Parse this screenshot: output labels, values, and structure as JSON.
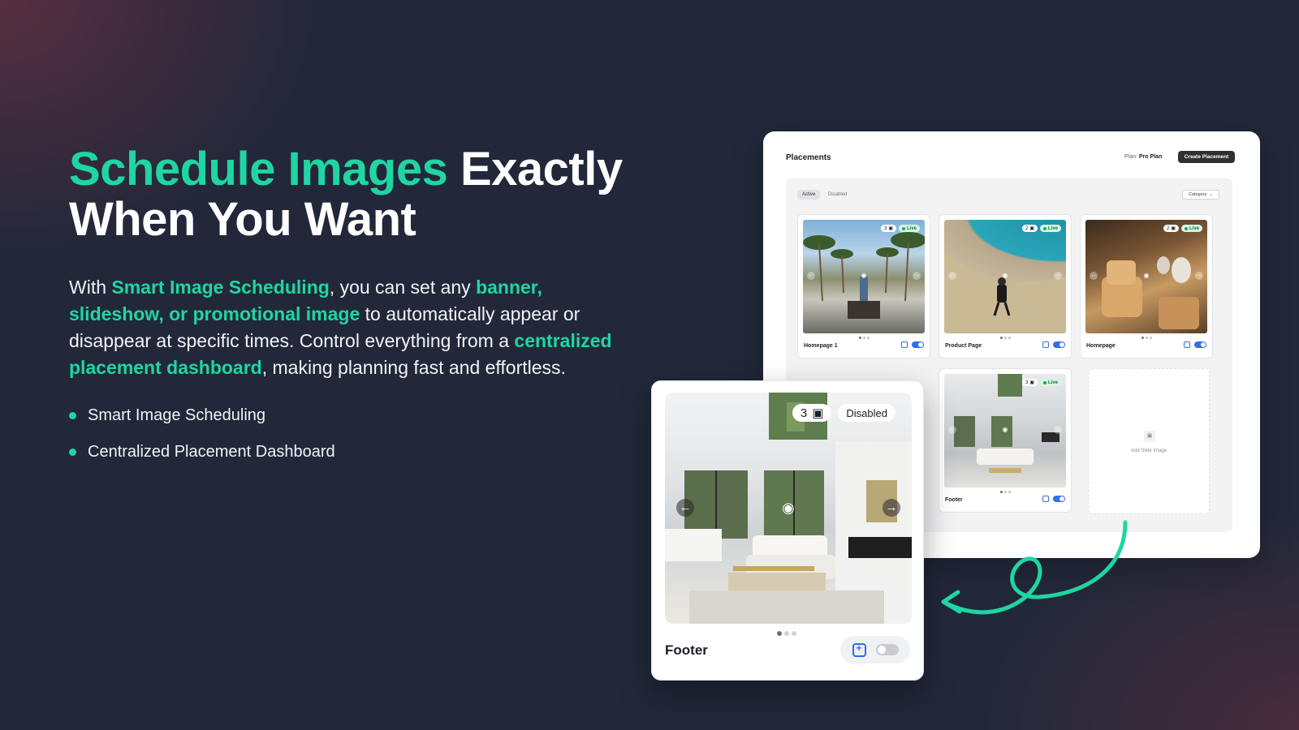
{
  "hero": {
    "headline_accent": "Schedule Images",
    "headline_rest_1": " Exactly",
    "headline_line_2": "When You Want",
    "para": {
      "p1": "With ",
      "h1": "Smart Image Scheduling",
      "p2": ", you can set any ",
      "h2": "banner, slideshow, or promotional image",
      "p3": " to automatically appear or disappear at specific times. Control everything from a ",
      "h3": "centralized placement dashboard",
      "p4": ", making planning fast and effortless."
    },
    "bullets": [
      "Smart Image Scheduling",
      "Centralized Placement Dashboard"
    ]
  },
  "dashboard": {
    "title": "Placements",
    "plan_label": "Plan: ",
    "plan_value": "Pro Plan",
    "create_button": "Create Placement",
    "tabs": [
      "Active",
      "Disabled"
    ],
    "category_label": "Category",
    "cards": [
      {
        "label": "Homepage 1",
        "count": "3",
        "status": "Live"
      },
      {
        "label": "Product Page",
        "count": "2",
        "status": "Live"
      },
      {
        "label": "Homepage",
        "count": "2",
        "status": "Live"
      },
      {
        "label": "Footer",
        "count": "3",
        "status": "Live"
      }
    ],
    "add_slide_label": "Add Slide Image"
  },
  "floating_card": {
    "count": "3",
    "status": "Disabled",
    "label": "Footer"
  },
  "colors": {
    "accent": "#1fd6a2",
    "background": "#22283a",
    "toggle_on": "#2f6fe8"
  }
}
